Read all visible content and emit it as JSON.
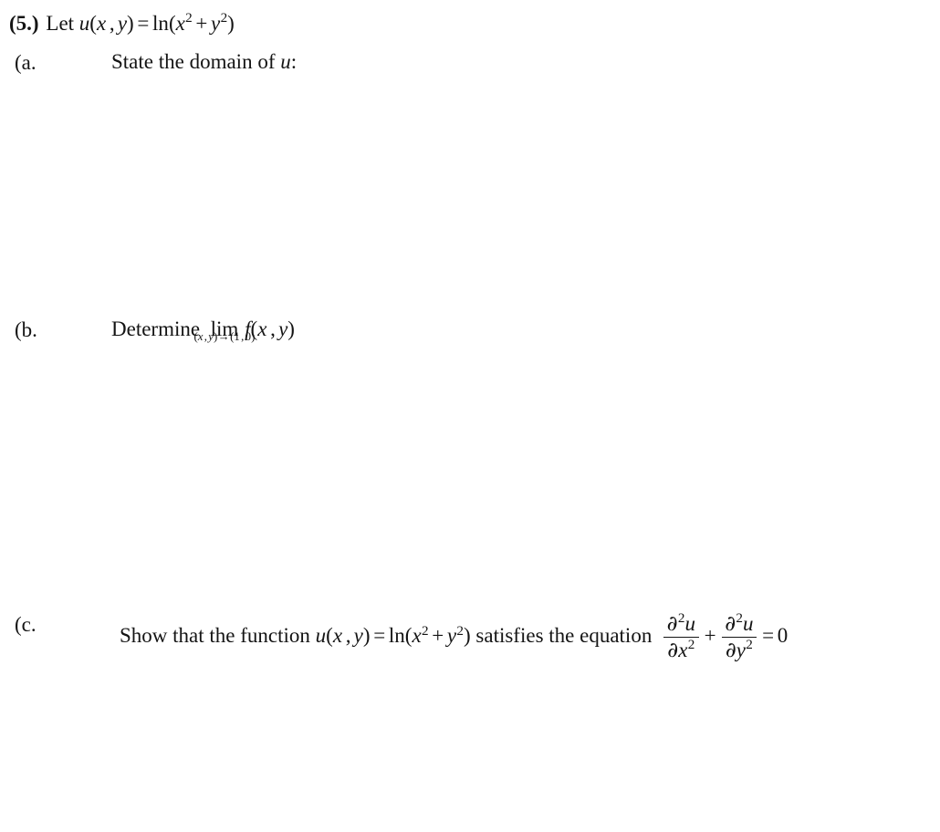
{
  "document": {
    "type": "math-worksheet",
    "background_color": "#ffffff",
    "text_color": "#141414",
    "problem_number": "(5.)"
  },
  "problem": {
    "number_label": "(5.)",
    "stem_prefix": "Let",
    "function_name": "u",
    "function_args_open": "(",
    "var_x": "x",
    "var_comma": ",",
    "var_y": "y",
    "function_args_close": ")",
    "equals": "=",
    "ln": "ln",
    "open_paren": "(",
    "x_base": "x",
    "x_exp": "2",
    "plus": "+",
    "y_base": "y",
    "y_exp": "2",
    "close_paren": ")",
    "full_text": "(5.) Let u(x, y) = ln(x² + y²)"
  },
  "parts": {
    "a": {
      "label": "(a.",
      "text": "State the domain of",
      "symbol": "u",
      "colon": ":",
      "full_text": "(a.   State the domain of u:"
    },
    "b": {
      "label": "(b.",
      "text": "Determine",
      "limit_operator": "lim",
      "limit_subscript_open": "(",
      "limit_sub_x": "x",
      "limit_sub_comma": ",",
      "limit_sub_y": "y",
      "limit_subscript_close": ")",
      "limit_arrow": "→",
      "limit_target_open": "(",
      "limit_target_x": "1",
      "limit_target_comma": ",",
      "limit_target_y": "0",
      "limit_target_close": ")",
      "limit_function": "f",
      "fn_open": "(",
      "fn_x": "x",
      "fn_comma": ",",
      "fn_y": "y",
      "fn_close": ")",
      "full_text": "(b.   Determine lim_{(x,y)→(1,0)} f(x, y)"
    },
    "c": {
      "label": "(c.",
      "text_before": "Show that the function",
      "function_name": "u",
      "args_open": "(",
      "arg_x": "x",
      "arg_comma": ",",
      "arg_y": "y",
      "args_close": ")",
      "equals": "=",
      "ln": "ln",
      "open_paren": "(",
      "x_base": "x",
      "x_exp": "2",
      "plus": "+",
      "y_base": "y",
      "y_exp": "2",
      "close_paren": ")",
      "text_after": "satisfies the equation",
      "equation": {
        "term1_num_partial": "∂",
        "term1_num_exp": "2",
        "term1_num_fn": "u",
        "term1_den_partial": "∂",
        "term1_den_var": "x",
        "term1_den_exp": "2",
        "operator": "+",
        "term2_num_partial": "∂",
        "term2_num_exp": "2",
        "term2_num_fn": "u",
        "term2_den_partial": "∂",
        "term2_den_var": "y",
        "term2_den_exp": "2",
        "equals": "=",
        "result": "0",
        "full_text": "∂2u/∂x² + ∂2u/∂y² = 0"
      },
      "full_text": "(c.   Show that the function u(x, y) = ln(x² + y²) satisfies the equation ∂²u/∂x² + ∂²u/∂y² = 0"
    }
  }
}
